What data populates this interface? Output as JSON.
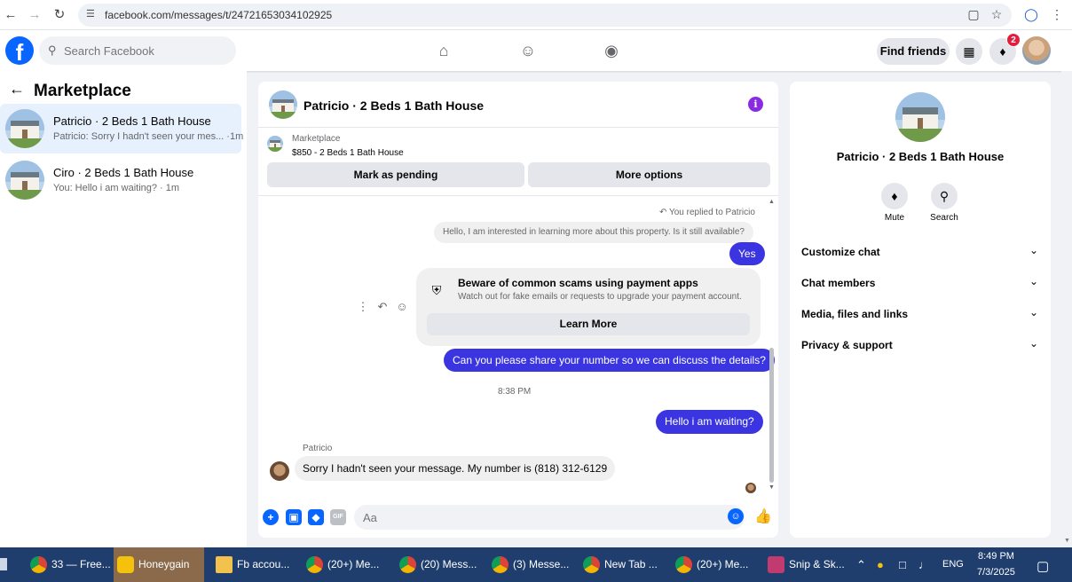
{
  "browser": {
    "url": "facebook.com/messages/t/24721653034102925"
  },
  "header": {
    "search_placeholder": "Search Facebook",
    "find_friends": "Find friends",
    "notification_count": "2"
  },
  "sidebar": {
    "title": "Marketplace",
    "conversations": [
      {
        "name": "Patricio · 2 Beds 1 Bath House",
        "snippet": "Patricio: Sorry I hadn't seen your mes... ·1m"
      },
      {
        "name": "Ciro · 2 Beds 1 Bath House",
        "snippet": "You: Hello i am waiting? · 1m"
      }
    ]
  },
  "chat": {
    "title": "Patricio · 2 Beds 1 Bath House",
    "listing_label": "Marketplace",
    "listing_price": "$850 - 2 Beds 1 Bath House",
    "mark_pending": "Mark as pending",
    "more_options": "More options",
    "replied_note": "You replied to Patricio",
    "quoted_message": "Hello, I am interested in learning more about this property. Is it still available?",
    "reply_yes": "Yes",
    "scam_title": "Beware of common scams using payment apps",
    "scam_subtitle": "Watch out for fake emails or requests to upgrade your payment account.",
    "learn_more": "Learn More",
    "outgoing_1": "Can you please share your number so we can discuss the details?",
    "timestamp": "8:38 PM",
    "outgoing_2": "Hello i am waiting?",
    "sender_name": "Patricio",
    "incoming_1": "Sorry I hadn't seen your message. My number is (818) 312-6129",
    "composer_placeholder": "Aa"
  },
  "details": {
    "name": "Patricio · 2 Beds 1 Bath House",
    "mute": "Mute",
    "search": "Search",
    "sections": [
      "Customize chat",
      "Chat members",
      "Media, files and links",
      "Privacy & support"
    ]
  },
  "taskbar": {
    "items": [
      "33 — Free...",
      "Honeygain",
      "Fb accou...",
      "(20+) Me...",
      "(20) Mess...",
      "(3) Messe...",
      "New Tab ...",
      "(20+) Me...",
      "Snip & Sk..."
    ],
    "language": "ENG",
    "time": "8:49 PM",
    "date": "7/3/2025"
  },
  "colors": {
    "fb_blue": "#0866ff",
    "outgoing_bubble": "#3a35e0",
    "info_purple": "#8a2be2",
    "taskbar": "#1f3e6e"
  }
}
